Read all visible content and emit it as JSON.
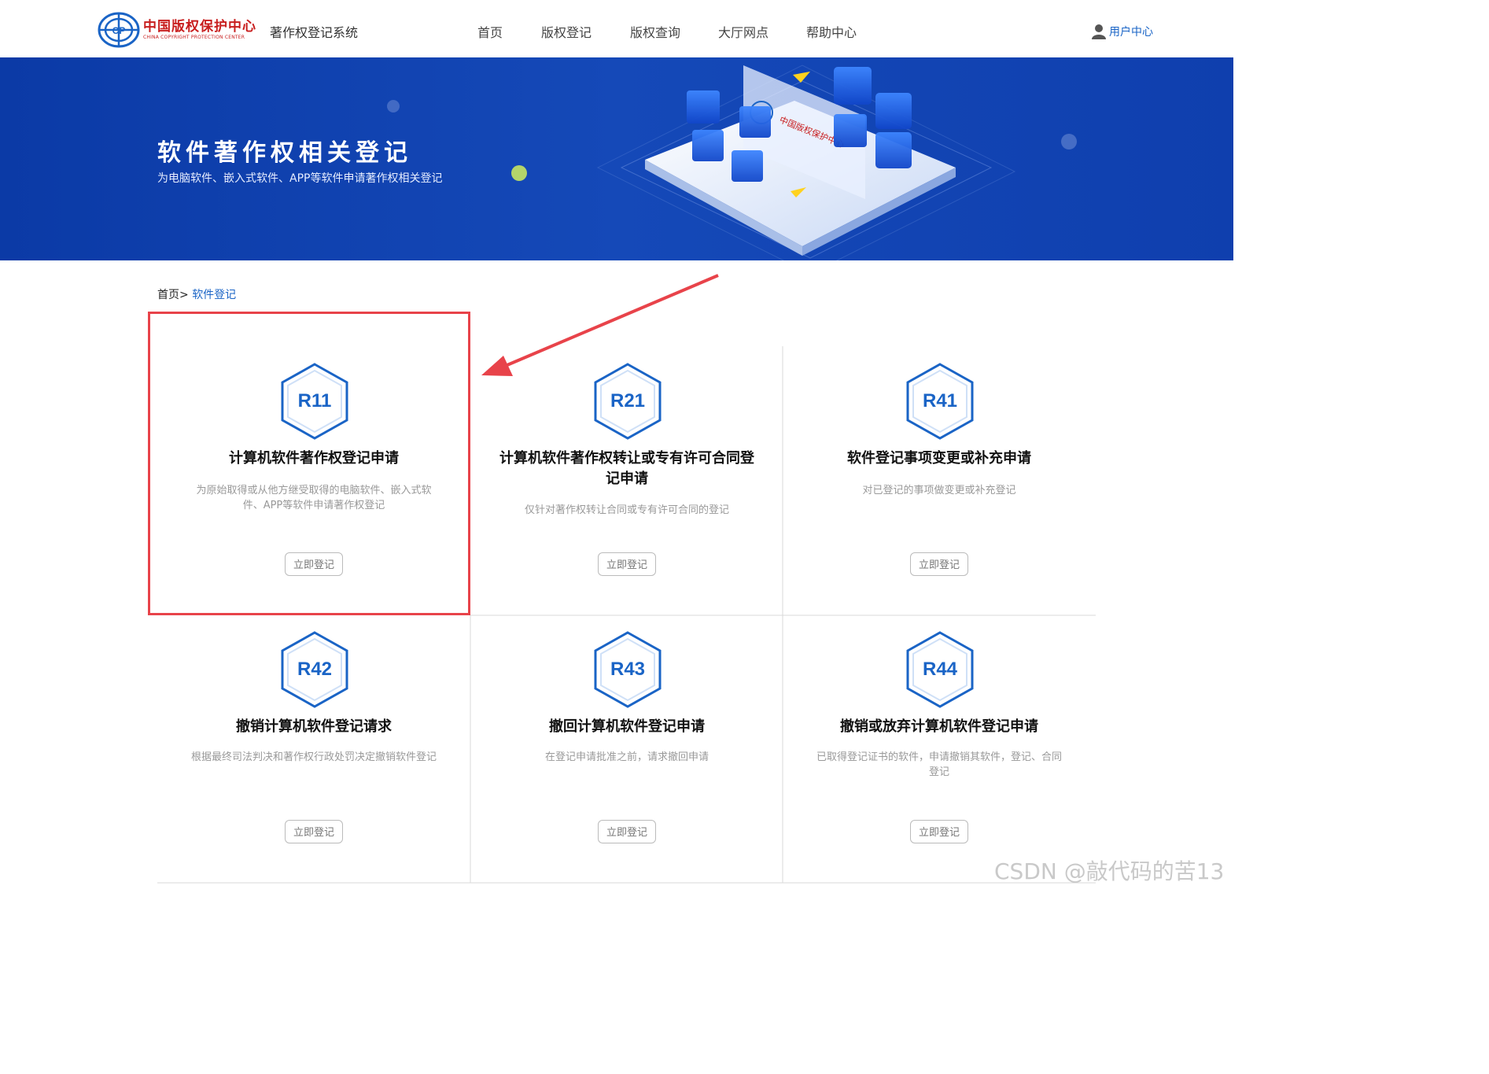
{
  "header": {
    "logo_cn": "中国版权保护中心",
    "logo_en": "CHINA COPYRIGHT PROTECTION CENTER",
    "system_name": "著作权登记系统",
    "nav": [
      "首页",
      "版权登记",
      "版权查询",
      "大厅网点",
      "帮助中心"
    ],
    "user_center": "用户中心"
  },
  "banner": {
    "title": "软件著作权相关登记",
    "subtitle": "为电脑软件、嵌入式软件、APP等软件申请著作权相关登记",
    "board_text": "中国版权保护中心",
    "board_subtext": "CHINA COPYRIGHT PROTECTION CENTER"
  },
  "breadcrumb": {
    "home": "首页",
    "separator": ">",
    "current": "软件登记"
  },
  "cards": [
    {
      "code": "R11",
      "title": "计算机软件著作权登记申请",
      "desc": "为原始取得或从他方继受取得的电脑软件、嵌入式软件、APP等软件申请著作权登记",
      "button": "立即登记"
    },
    {
      "code": "R21",
      "title": "计算机软件著作权转让或专有许可合同登记申请",
      "desc": "仅针对著作权转让合同或专有许可合同的登记",
      "button": "立即登记"
    },
    {
      "code": "R41",
      "title": "软件登记事项变更或补充申请",
      "desc": "对已登记的事项做变更或补充登记",
      "button": "立即登记"
    },
    {
      "code": "R42",
      "title": "撤销计算机软件登记请求",
      "desc": "根据最终司法判决和著作权行政处罚决定撤销软件登记",
      "button": "立即登记"
    },
    {
      "code": "R43",
      "title": "撤回计算机软件登记申请",
      "desc": "在登记申请批准之前，请求撤回申请",
      "button": "立即登记"
    },
    {
      "code": "R44",
      "title": "撤销或放弃计算机软件登记申请",
      "desc": "已取得登记证书的软件，申请撤销其软件，登记、合同登记",
      "button": "立即登记"
    }
  ],
  "watermark": "CSDN @敲代码的苦13",
  "colors": {
    "brand_blue": "#1a64c6",
    "banner_blue": "#0f3fae",
    "logo_red": "#c81e1e",
    "highlight_red": "#e8434a"
  }
}
